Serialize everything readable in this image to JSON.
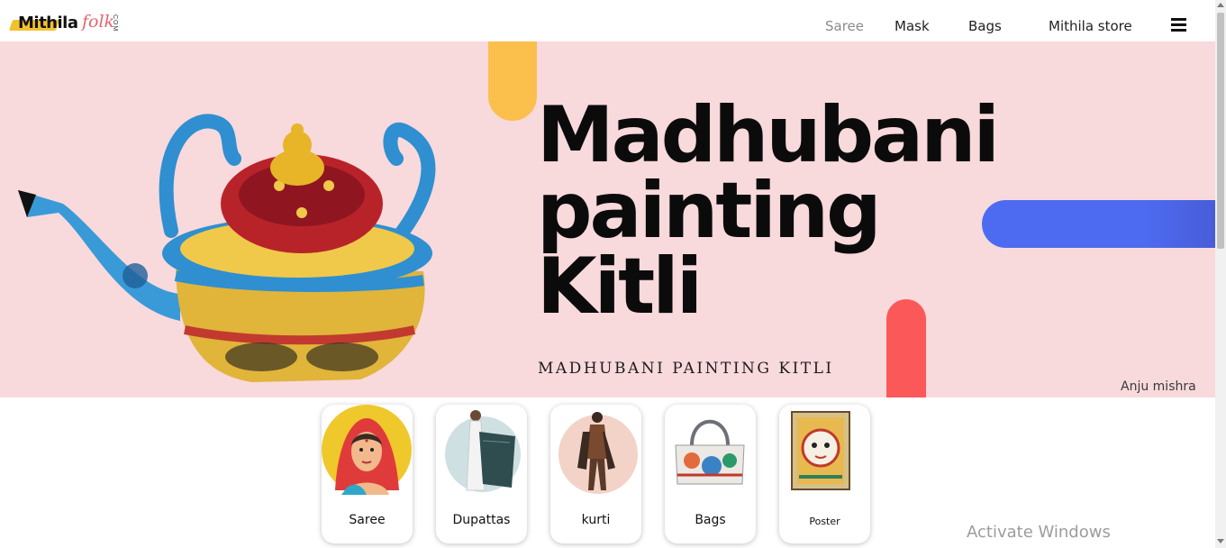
{
  "logo": {
    "brand": "Mithila",
    "accent": "folk",
    "suffix": "COM"
  },
  "nav": {
    "items": [
      "Saree",
      "Mask",
      "Bags",
      "Mithila store"
    ]
  },
  "banner": {
    "title_line1": "Madhubani",
    "title_line2": "painting",
    "title_line3": "Kitli",
    "subtitle": "MADHUBANI PAINTING  KITLI",
    "author": "Anju mishra",
    "colors": {
      "background": "#f8d9dc",
      "yellow": "#fbbf4b",
      "blue": "#4d6bf0",
      "red": "#fb5959"
    }
  },
  "categories": [
    {
      "label": "Saree",
      "icon": "saree-woman-avatar"
    },
    {
      "label": "Dupattas",
      "icon": "dupatta-figure"
    },
    {
      "label": "kurti",
      "icon": "kurti-figure"
    },
    {
      "label": "Bags",
      "icon": "painted-handbag"
    },
    {
      "label": "Poster",
      "icon": "madhubani-face-poster"
    }
  ],
  "overlay": {
    "watermark": "Activate Windows"
  }
}
